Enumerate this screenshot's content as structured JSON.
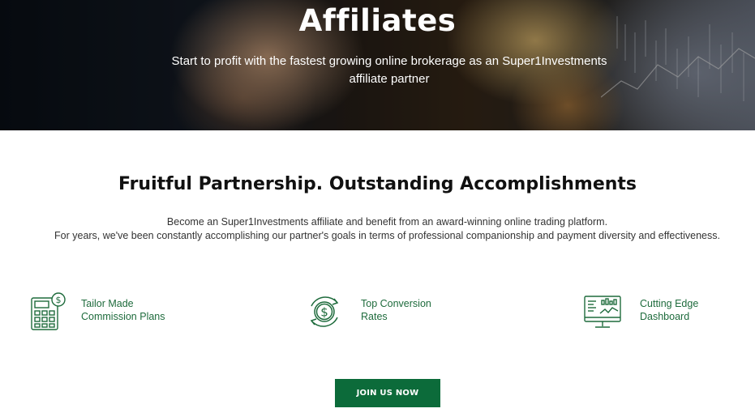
{
  "hero": {
    "title": "Affiliates",
    "subtitle_line1": "Start to profit with the fastest growing online brokerage as an Super1Investments",
    "subtitle_line2": "affiliate partner"
  },
  "section": {
    "title": "Fruitful Partnership. Outstanding Accomplishments",
    "intro_line1": "Become an Super1Investments affiliate and benefit from an award-winning online trading platform.",
    "intro_line2": "For years, we've been constantly accomplishing our partner's goals in terms of professional companionship and payment diversity and effectiveness."
  },
  "features": [
    {
      "icon": "calculator-dollar-icon",
      "line1": "Tailor Made",
      "line2": "Commission Plans"
    },
    {
      "icon": "dollar-cycle-icon",
      "line1": "Top Conversion",
      "line2": "Rates"
    },
    {
      "icon": "dashboard-monitor-icon",
      "line1": "Cutting Edge",
      "line2": "Dashboard"
    }
  ],
  "cta": {
    "label": "JOIN US NOW"
  },
  "colors": {
    "accent": "#0c6b3a",
    "feature_text": "#1e6b3c",
    "icon_stroke": "#1e6b3c"
  }
}
